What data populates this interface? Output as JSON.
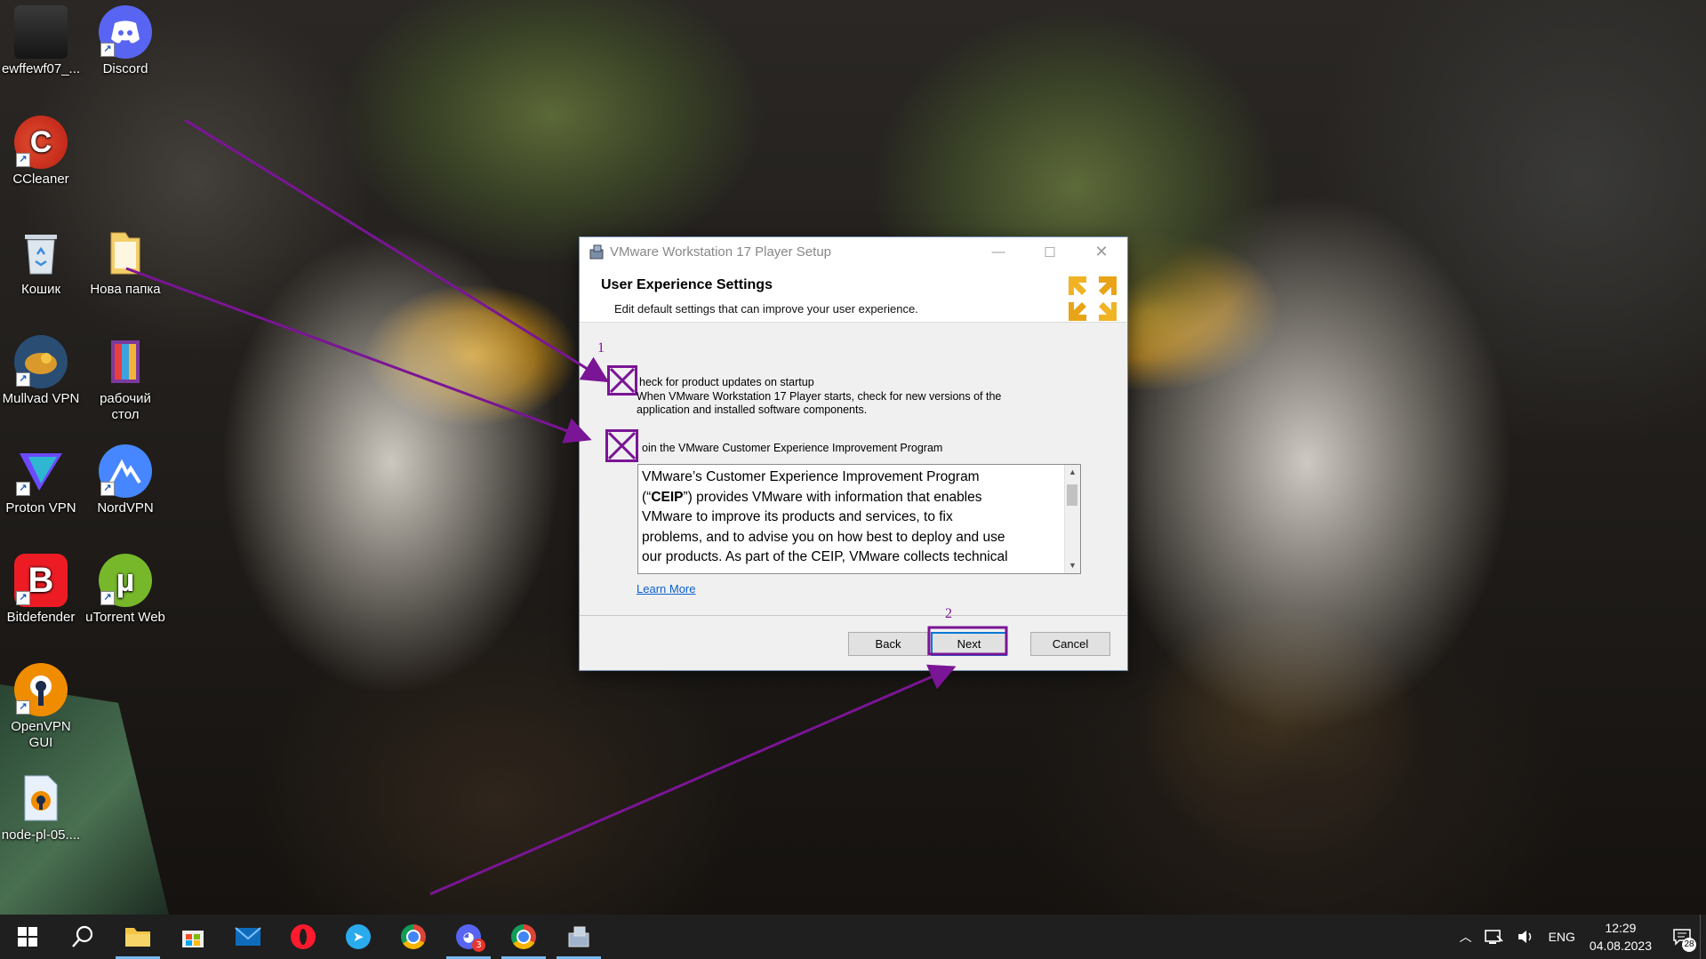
{
  "desktop": {
    "icons": [
      {
        "label": "ewffewf07_..."
      },
      {
        "label": "Discord"
      },
      {
        "label": "CCleaner"
      },
      {
        "label": "Кошик"
      },
      {
        "label": "Нова папка"
      },
      {
        "label": "Mullvad VPN"
      },
      {
        "label": "рабочий стол"
      },
      {
        "label": "Proton VPN"
      },
      {
        "label": "NordVPN"
      },
      {
        "label": "Bitdefender"
      },
      {
        "label": "uTorrent Web"
      },
      {
        "label": "OpenVPN GUI"
      },
      {
        "label": "node-pl-05...."
      }
    ]
  },
  "dialog": {
    "window_title": "VMware Workstation 17 Player Setup",
    "header_title": "User Experience Settings",
    "header_subtitle": "Edit default settings that can improve your user experience.",
    "option_updates": {
      "label": "heck for product updates on startup",
      "description": "When VMware Workstation 17 Player starts, check for new versions of the application and installed software components."
    },
    "option_ceip": {
      "label": "oin the VMware Customer Experience Improvement Program"
    },
    "ceip_text_lines": [
      "VMware’s Customer Experience Improvement Program",
      "(“CEIP”) provides VMware with information that enables",
      "VMware to improve its products and services, to fix",
      "problems, and to advise you on how best to deploy and use",
      "our products. As part of the CEIP, VMware collects technical"
    ],
    "learn_more": "Learn More",
    "buttons": {
      "back": "Back",
      "next": "Next",
      "cancel": "Cancel"
    }
  },
  "annotations": {
    "num1": "1",
    "num2": "2",
    "color": "#7a1595"
  },
  "taskbar": {
    "language": "ENG",
    "time": "12:29",
    "date": "04.08.2023",
    "notifications": "28",
    "discord_badge": "3"
  }
}
